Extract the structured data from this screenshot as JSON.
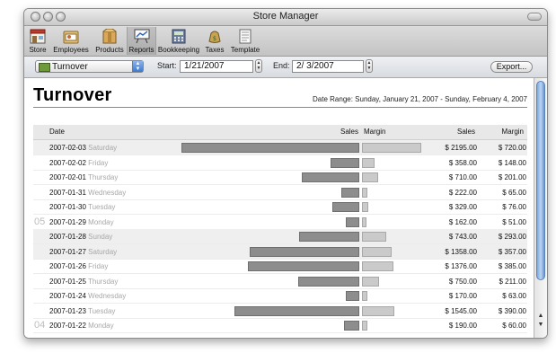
{
  "window": {
    "title": "Store Manager"
  },
  "toolbar": {
    "items": [
      {
        "label": "Store",
        "icon": "store-icon"
      },
      {
        "label": "Employees",
        "icon": "employees-icon"
      },
      {
        "label": "Products",
        "icon": "products-icon"
      },
      {
        "label": "Reports",
        "icon": "reports-icon",
        "active": true
      },
      {
        "label": "Bookkeeping",
        "icon": "bookkeeping-icon"
      },
      {
        "label": "Taxes",
        "icon": "taxes-icon"
      },
      {
        "label": "Template",
        "icon": "template-icon"
      }
    ]
  },
  "filter": {
    "report_type": "Turnover",
    "start_label": "Start:",
    "start_value": "1/21/2007",
    "end_label": "End:",
    "end_value": "2/  3/2007",
    "export_label": "Export..."
  },
  "report": {
    "title": "Turnover",
    "date_range": "Date Range: Sunday, January 21, 2007 - Sunday, February 4, 2007",
    "columns": {
      "date": "Date",
      "sales_bar": "Sales",
      "margin_bar": "Margin",
      "sales": "Sales",
      "margin": "Margin"
    },
    "week_markers": [
      {
        "label": "05",
        "row": 5
      },
      {
        "label": "04",
        "row": 12
      }
    ],
    "max_sales": 2195,
    "max_margin": 720,
    "rows": [
      {
        "date": "2007-02-03",
        "day": "Saturday",
        "sales": 2195,
        "margin": 720,
        "sales_text": "$ 2195.00",
        "margin_text": "$ 720.00",
        "weekend": true
      },
      {
        "date": "2007-02-02",
        "day": "Friday",
        "sales": 358,
        "margin": 148,
        "sales_text": "$ 358.00",
        "margin_text": "$ 148.00",
        "weekend": false
      },
      {
        "date": "2007-02-01",
        "day": "Thursday",
        "sales": 710,
        "margin": 201,
        "sales_text": "$ 710.00",
        "margin_text": "$ 201.00",
        "weekend": false
      },
      {
        "date": "2007-01-31",
        "day": "Wednesday",
        "sales": 222,
        "margin": 65,
        "sales_text": "$ 222.00",
        "margin_text": "$ 65.00",
        "weekend": false
      },
      {
        "date": "2007-01-30",
        "day": "Tuesday",
        "sales": 329,
        "margin": 76,
        "sales_text": "$ 329.00",
        "margin_text": "$ 76.00",
        "weekend": false
      },
      {
        "date": "2007-01-29",
        "day": "Monday",
        "sales": 162,
        "margin": 51,
        "sales_text": "$ 162.00",
        "margin_text": "$ 51.00",
        "weekend": false
      },
      {
        "date": "2007-01-28",
        "day": "Sunday",
        "sales": 743,
        "margin": 293,
        "sales_text": "$ 743.00",
        "margin_text": "$ 293.00",
        "weekend": true
      },
      {
        "date": "2007-01-27",
        "day": "Saturday",
        "sales": 1358,
        "margin": 357,
        "sales_text": "$ 1358.00",
        "margin_text": "$ 357.00",
        "weekend": true
      },
      {
        "date": "2007-01-26",
        "day": "Friday",
        "sales": 1376,
        "margin": 385,
        "sales_text": "$ 1376.00",
        "margin_text": "$ 385.00",
        "weekend": false
      },
      {
        "date": "2007-01-25",
        "day": "Thursday",
        "sales": 750,
        "margin": 211,
        "sales_text": "$ 750.00",
        "margin_text": "$ 211.00",
        "weekend": false
      },
      {
        "date": "2007-01-24",
        "day": "Wednesday",
        "sales": 170,
        "margin": 63,
        "sales_text": "$ 170.00",
        "margin_text": "$ 63.00",
        "weekend": false
      },
      {
        "date": "2007-01-23",
        "day": "Tuesday",
        "sales": 1545,
        "margin": 390,
        "sales_text": "$ 1545.00",
        "margin_text": "$ 390.00",
        "weekend": false
      },
      {
        "date": "2007-01-22",
        "day": "Monday",
        "sales": 190,
        "margin": 60,
        "sales_text": "$ 190.00",
        "margin_text": "$ 60.00",
        "weekend": false
      }
    ]
  },
  "colors": {
    "sales_bar": "#8d8d8d",
    "margin_bar": "#cacaca",
    "weekend_row": "#efefef",
    "scroll_thumb": "#7ea7dc"
  }
}
